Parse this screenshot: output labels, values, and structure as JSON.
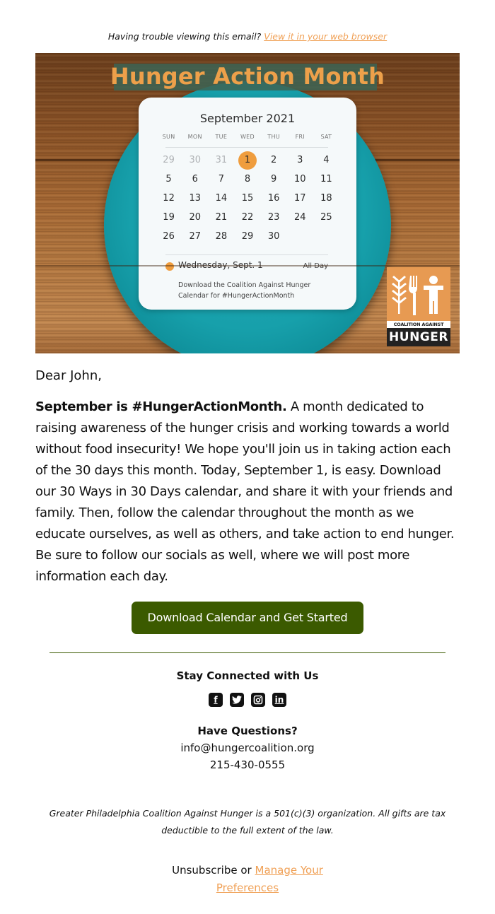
{
  "preheader": {
    "text": "Having trouble viewing this email?",
    "link_label": "View it in your web browser"
  },
  "hero": {
    "title": "Hunger Action Month",
    "calendar": {
      "month": "September 2021",
      "weekdays": [
        "SUN",
        "MON",
        "TUE",
        "WED",
        "THU",
        "FRI",
        "SAT"
      ],
      "days": [
        {
          "d": "29",
          "muted": true
        },
        {
          "d": "30",
          "muted": true
        },
        {
          "d": "31",
          "muted": true
        },
        {
          "d": "1",
          "today": true
        },
        {
          "d": "2"
        },
        {
          "d": "3"
        },
        {
          "d": "4"
        },
        {
          "d": "5"
        },
        {
          "d": "6"
        },
        {
          "d": "7"
        },
        {
          "d": "8"
        },
        {
          "d": "9"
        },
        {
          "d": "10"
        },
        {
          "d": "11"
        },
        {
          "d": "12"
        },
        {
          "d": "13"
        },
        {
          "d": "14"
        },
        {
          "d": "15"
        },
        {
          "d": "16"
        },
        {
          "d": "17"
        },
        {
          "d": "18"
        },
        {
          "d": "19"
        },
        {
          "d": "20"
        },
        {
          "d": "21"
        },
        {
          "d": "22"
        },
        {
          "d": "23"
        },
        {
          "d": "24"
        },
        {
          "d": "25"
        },
        {
          "d": "26"
        },
        {
          "d": "27"
        },
        {
          "d": "28"
        },
        {
          "d": "29"
        },
        {
          "d": "30"
        }
      ],
      "event_date": "Wednesday, Sept. 1",
      "event_time": "All Day",
      "event_desc": "Download the Coalition Against Hunger Calendar for #HungerActionMonth"
    },
    "logo": {
      "line1": "COALITION AGAINST",
      "line2": "HUNGER"
    }
  },
  "greeting": "Dear John,",
  "body": {
    "lead_bold": "September is #HungerActionMonth.",
    "text": " A month dedicated to raising awareness of the hunger crisis and working towards a world without food insecurity! We hope you'll join us in taking action each of the 30 days this month. Today, September 1, is easy. Download our 30 Ways in 30 Days calendar, and share it with your friends and family. Then, follow the calendar throughout the month as we educate ourselves, as well as others, and take action to end hunger. Be sure to follow our socials as well, where we will post more information each day."
  },
  "cta_label": "Download Calendar and Get Started",
  "footer": {
    "stay_connected": "Stay Connected with Us",
    "socials": [
      {
        "name": "facebook",
        "glyph": "f"
      },
      {
        "name": "twitter",
        "glyph": "t"
      },
      {
        "name": "instagram",
        "glyph": "◙"
      },
      {
        "name": "linkedin",
        "glyph": "in"
      }
    ],
    "questions_heading": "Have Questions?",
    "email": "info@hungercoalition.org",
    "phone": "215-430-0555",
    "legal": "Greater Philadelphia Coalition Against Hunger is a 501(c)(3) organization. All gifts are tax deductible to the full extent of the law.",
    "unsubscribe_label": "Unsubscribe",
    "or_text": " or ",
    "manage_label": "Manage Your Preferences"
  },
  "colors": {
    "accent_orange": "#f0a055",
    "cta_green": "#3b5a00",
    "calendar_highlight": "#ef9d3e"
  }
}
